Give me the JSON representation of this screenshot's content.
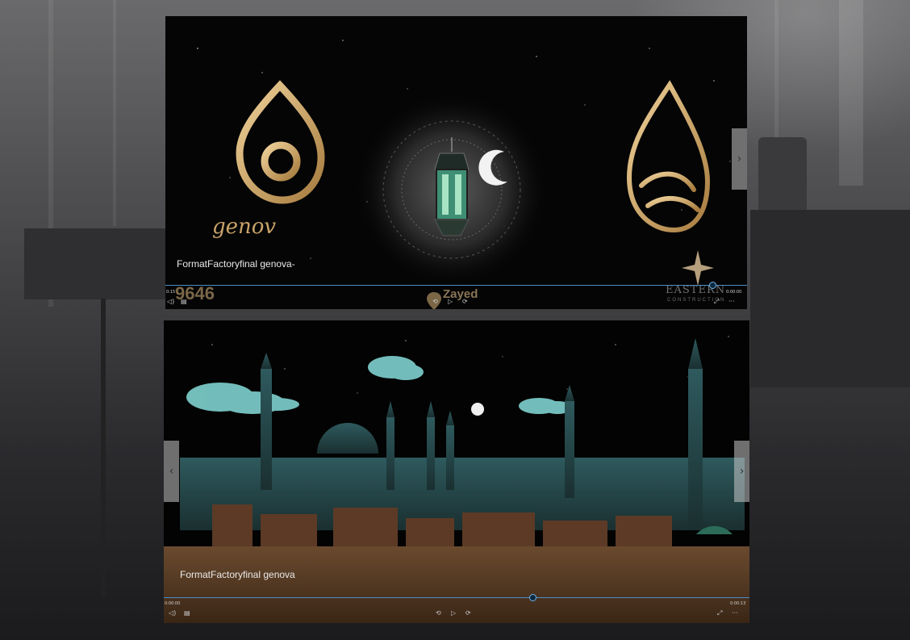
{
  "players": [
    {
      "caption": "FormatFactoryfinal genova-",
      "time_elapsed": "0:15",
      "time_remaining": "0:00:00",
      "progress": 0.94,
      "overlay": {
        "left_number": "9646",
        "location_label": "Zayed",
        "logo_text": "genov",
        "brand_top": "EASTERN",
        "brand_bottom": "CONSTRUCTION"
      }
    },
    {
      "caption": "FormatFactoryfinal genova",
      "time_elapsed": "0:00:00",
      "time_remaining": "0:00:13",
      "progress": 0.63
    }
  ],
  "controls": {
    "prev_label": "‹",
    "next_label": "›",
    "rewind_icon": "⟲",
    "play_icon": "▷",
    "forward_icon": "⟳",
    "volume_icon": "◁)",
    "subtitles_icon": "▤",
    "fullscreen_icon": "⤢",
    "more_icon": "···"
  },
  "colors": {
    "accent": "#4b8dc7",
    "gold": "#c9a36a",
    "teal": "#5fb6b6"
  }
}
